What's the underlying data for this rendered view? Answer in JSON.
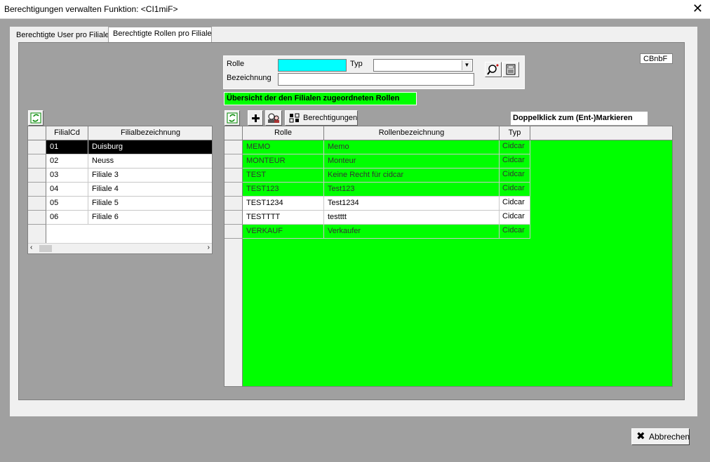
{
  "window": {
    "title": "Berechtigungen verwalten   Funktion: <CI1miF>",
    "close_glyph": "✕"
  },
  "tabs": [
    {
      "label": "Berechtigte User pro Filiale",
      "active": false
    },
    {
      "label": "Berechtigte Rollen pro Filiale",
      "active": true
    }
  ],
  "code_box": "CBnbF",
  "filter": {
    "rolle_label": "Rolle",
    "rolle_value": "",
    "typ_label": "Typ",
    "typ_value": "",
    "bezeichnung_label": "Bezeichnung",
    "bezeichnung_value": ""
  },
  "banner": "Übersicht der den Filialen zugeordneten Rollen",
  "hint": "Doppelklick zum (Ent-)Markieren",
  "toolbar": {
    "berechtigungen_label": "Berechtigungen"
  },
  "filialen": {
    "headers": [
      "FilialCd",
      "Filialbezeichnung"
    ],
    "rows": [
      {
        "cd": "01",
        "name": "Duisburg"
      },
      {
        "cd": "02",
        "name": "Neuss"
      },
      {
        "cd": "03",
        "name": "Filiale 3"
      },
      {
        "cd": "04",
        "name": "Filiale 4"
      },
      {
        "cd": "05",
        "name": "Filiale 5"
      },
      {
        "cd": "06",
        "name": "Filiale 6"
      }
    ],
    "selected_index": 0,
    "scroll_left": "‹",
    "scroll_right": "›"
  },
  "rollen": {
    "headers": [
      "Rolle",
      "Rollenbezeichnung",
      "Typ"
    ],
    "rows": [
      {
        "rolle": "MEMO",
        "bez": "Memo",
        "typ": "Cidcar",
        "marked": true
      },
      {
        "rolle": "MONTEUR",
        "bez": "Monteur",
        "typ": "Cidcar",
        "marked": true
      },
      {
        "rolle": "TEST",
        "bez": "Keine Recht für cidcar",
        "typ": "Cidcar",
        "marked": true
      },
      {
        "rolle": "TEST123",
        "bez": "Test123",
        "typ": "Cidcar",
        "marked": true
      },
      {
        "rolle": "TEST1234",
        "bez": "Test1234",
        "typ": "Cidcar",
        "marked": false
      },
      {
        "rolle": "TESTTTT",
        "bez": "testttt",
        "typ": "Cidcar",
        "marked": false
      },
      {
        "rolle": "VERKAUF",
        "bez": "Verkaufer",
        "typ": "Cidcar",
        "marked": true
      }
    ]
  },
  "buttons": {
    "abbrechen": "Abbrechen",
    "abbrechen_glyph": "✖"
  },
  "colors": {
    "marked_row": "#00ff00",
    "rolle_field": "#00ffff",
    "selected_row": "#000000"
  },
  "icons": [
    "refresh-icon",
    "add-icon",
    "users-icon",
    "permissions-icon",
    "search-icon",
    "calculator-icon",
    "close-icon"
  ]
}
